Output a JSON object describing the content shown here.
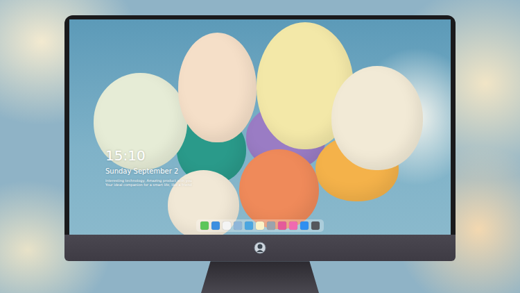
{
  "lock_screen": {
    "time": "15:10",
    "date": "Sunday September 2",
    "caption_lines": [
      "Interesting technology, Amazing product with you",
      "Your ideal companion for a smart life, like a friend"
    ]
  },
  "dock": {
    "items": [
      {
        "color": "#5cc65a"
      },
      {
        "color": "#3d8fe0"
      },
      {
        "color": "#f4f4f4"
      },
      {
        "color": "#8fb6d8"
      },
      {
        "color": "#4aa6e0"
      },
      {
        "color": "#fbf3c8"
      },
      {
        "color": "#9aa3ad"
      },
      {
        "color": "#e45a9a"
      },
      {
        "color": "#f06ab0"
      },
      {
        "color": "#2f8ff0"
      },
      {
        "color": "#55575c"
      }
    ]
  }
}
